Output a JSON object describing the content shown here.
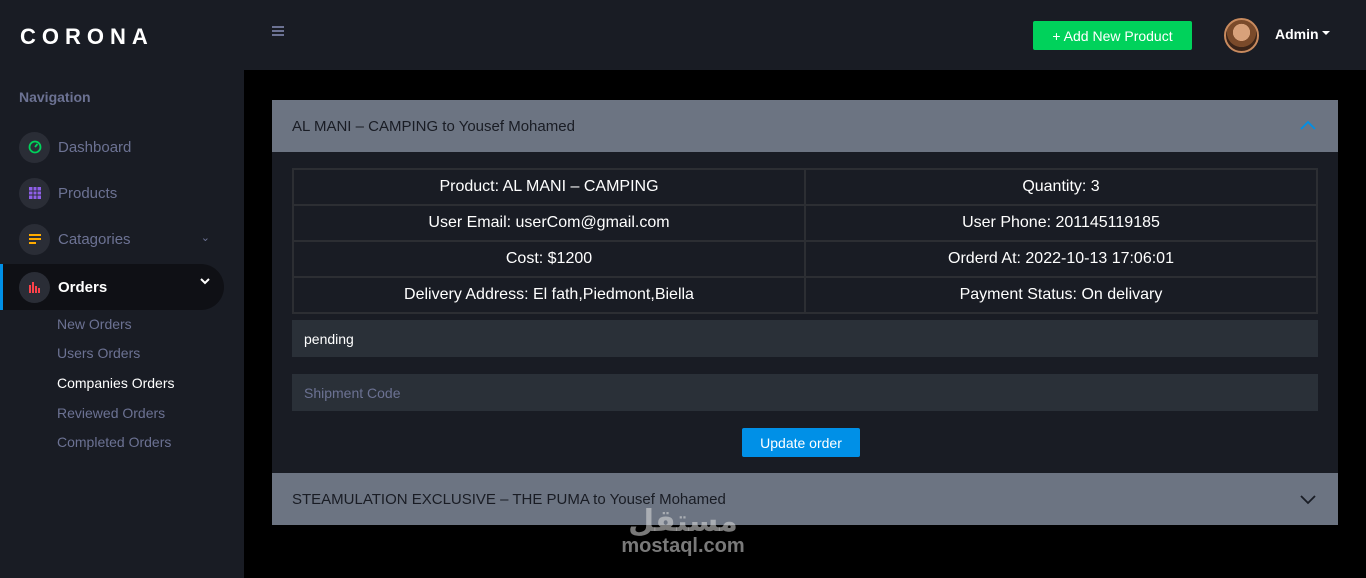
{
  "brand": "CORONA",
  "sidebar": {
    "heading": "Navigation",
    "items": [
      {
        "label": "Dashboard",
        "icon": "speedometer-icon",
        "color": "#00d25b"
      },
      {
        "label": "Products",
        "icon": "grid-icon",
        "color": "#8f5fe8"
      },
      {
        "label": "Catagories",
        "icon": "playlist-icon",
        "color": "#ffab00"
      },
      {
        "label": "Orders",
        "icon": "chart-bar-icon",
        "color": "#fc424a"
      }
    ],
    "sub_items": [
      "New Orders",
      "Users Orders",
      "Companies Orders",
      "Reviewed Orders",
      "Completed Orders"
    ],
    "active_sub_item": "Companies Orders"
  },
  "topbar": {
    "add_button": "+ Add New Product",
    "user": "Admin"
  },
  "orders": [
    {
      "title": "AL MANI – CAMPING to Yousef Mohamed",
      "expanded": true,
      "rows": [
        [
          "Product: AL MANI – CAMPING",
          "Quantity: 3"
        ],
        [
          "User Email: userCom@gmail.com",
          "User Phone: 201145119185"
        ],
        [
          "Cost: $1200",
          "Orderd At: 2022-10-13 17:06:01"
        ],
        [
          "Delivery Address: El fath,Piedmont,Biella",
          "Payment Status: On delivary"
        ]
      ],
      "status": "pending",
      "shipment_placeholder": "Shipment Code",
      "update_button": "Update order"
    },
    {
      "title": "STEAMULATION EXCLUSIVE – THE PUMA to Yousef Mohamed",
      "expanded": false
    }
  ],
  "watermark": {
    "arabic": "مستقل",
    "latin": "mostaql.com"
  },
  "colors": {
    "sidebar_bg": "#191c24",
    "content_bg": "#000000",
    "accent_blue": "#0090e7",
    "success_green": "#00d25b",
    "panel_header": "#6c7482",
    "muted_text": "#6c7293"
  }
}
